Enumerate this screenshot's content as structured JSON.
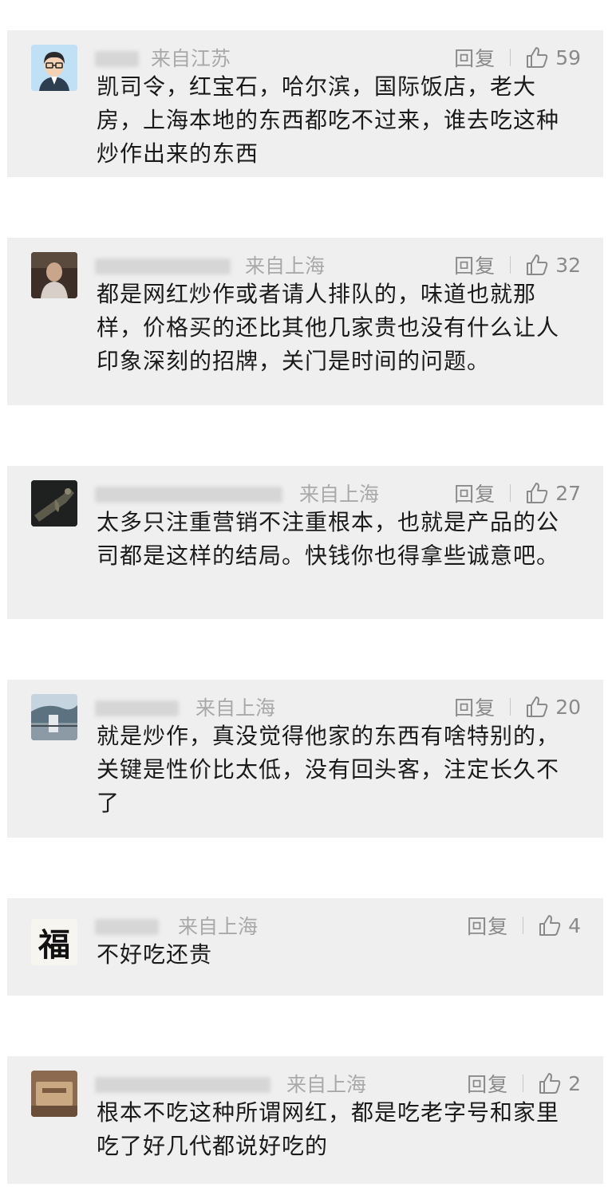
{
  "labels": {
    "reply": "回复"
  },
  "comments": [
    {
      "location": "来自江苏",
      "likes": "59",
      "text": "凯司令，红宝石，哈尔滨，国际饭店，老大房，上海本地的东西都吃不过来，谁去吃这种炒作出来的东西"
    },
    {
      "location": "来自上海",
      "likes": "32",
      "text": "都是网红炒作或者请人排队的，味道也就那样，价格买的还比其他几家贵也没有什么让人印象深刻的招牌，关门是时间的问题。"
    },
    {
      "location": "来自上海",
      "likes": "27",
      "text": "太多只注重营销不注重根本，也就是产品的公司都是这样的结局。快钱你也得拿些诚意吧。"
    },
    {
      "location": "来自上海",
      "likes": "20",
      "text": "就是炒作，真没觉得他家的东西有啥特别的，关键是性价比太低，没有回头客，注定长久不了"
    },
    {
      "location": "来自上海",
      "likes": "4",
      "text": "不好吃还贵",
      "avatar_char": "福"
    },
    {
      "location": "来自上海",
      "likes": "2",
      "text": "根本不吃这种所谓网红，都是吃老字号和家里吃了好几代都说好吃的"
    }
  ]
}
